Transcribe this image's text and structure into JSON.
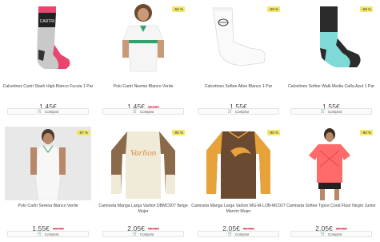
{
  "products": [
    {
      "name": "Calcetines Cartri Slash High Blanco Fucsia 1 Par",
      "price": "1.45€",
      "old_price": "",
      "badge": "",
      "buy_label": "Comprar",
      "image_icon": "sock-grey-pink-icon"
    },
    {
      "name": "Polo Cartri Neema Blanco Verde",
      "price": "1.45€",
      "old_price": "12.95€",
      "badge": "-56 %",
      "buy_label": "Comprar",
      "image_icon": "polo-white-green-icon"
    },
    {
      "name": "Calcetines Softee Altos Blanco 1 Par",
      "price": "1.55€",
      "old_price": "",
      "badge": "-69 %",
      "buy_label": "Comprar",
      "image_icon": "sock-white-icon"
    },
    {
      "name": "Calcetines Softee Walk Media Caña Azul 1 Par",
      "price": "1.55€",
      "old_price": "",
      "badge": "-69 %",
      "buy_label": "Comprar",
      "image_icon": "sock-aqua-black-icon"
    },
    {
      "name": "Polo Cartri Serena Blanco Verde",
      "price": "1.55€",
      "old_price": "13.95€",
      "badge": "-87 %",
      "buy_label": "Comprar",
      "image_icon": "tank-top-white-icon"
    },
    {
      "name": "Camiseta Manga Larga Varlion DBMC007 Beige Mujer",
      "price": "2.05€",
      "old_price": "30.95€",
      "badge": "-95 %",
      "buy_label": "Comprar",
      "image_icon": "longsleeve-beige-icon"
    },
    {
      "name": "Camiseta Manga Larga Varlion MG-M-LOB-MC027 Marrón Mujer",
      "price": "2.05€",
      "old_price": "35.95€",
      "badge": "-95 %",
      "buy_label": "Comprar",
      "image_icon": "longsleeve-brown-icon"
    },
    {
      "name": "Camiseta Softee Typos Coral Fluor Negro Junior",
      "price": "2.05€",
      "old_price": "20.95€",
      "badge": "-90 %",
      "buy_label": "Comprar",
      "image_icon": "tshirt-coral-icon"
    }
  ],
  "colors": {
    "badge_bg": "#f1e76a",
    "old_price": "#d84a6a",
    "text": "#444444"
  }
}
